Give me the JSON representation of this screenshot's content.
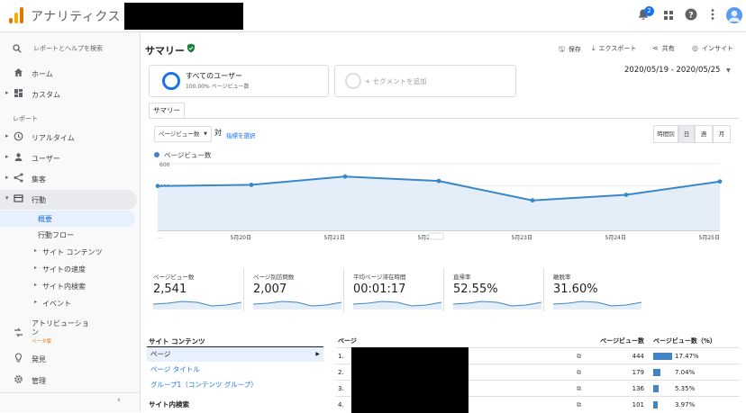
{
  "app": {
    "title": "アナリティクス",
    "notification_count": "2"
  },
  "sidebar": {
    "search_placeholder": "レポートとヘルプを検索",
    "home": "ホーム",
    "custom": "カスタム",
    "reports_section": "レポート",
    "realtime": "リアルタイム",
    "users": "ユーザー",
    "acquisition": "集客",
    "behavior": "行動",
    "overview": "概要",
    "behavior_flow": "行動フロー",
    "site_content": "サイト コンテンツ",
    "site_speed": "サイトの速度",
    "site_search": "サイト内検索",
    "events": "イベント",
    "attribution_line1": "アトリビューショ",
    "attribution_line2": "ン",
    "beta": "ベータ版",
    "discover": "発見",
    "admin": "管理"
  },
  "header": {
    "title": "サマリー",
    "save": "保存",
    "export": "エクスポート",
    "share": "共有",
    "insights": "インサイト"
  },
  "segments": {
    "all_users": "すべてのユーザー",
    "all_users_sub": "100.00% ページビュー数",
    "add_segment": "+ セグメントを追加"
  },
  "date_range": "2020/05/19 - 2020/05/25",
  "tab": "サマリー",
  "controls": {
    "metric": "ページビュー数",
    "vs": "対",
    "choose_metric": "指標を選択",
    "hourly": "時間別",
    "day": "日",
    "week": "週",
    "month": "月"
  },
  "chart_data": {
    "type": "line",
    "series": [
      {
        "name": "ページビュー数",
        "values": [
          400,
          410,
          485,
          445,
          270,
          320,
          440
        ]
      }
    ],
    "x": [
      "5/19",
      "5/20",
      "5/21",
      "5/22",
      "5/23",
      "5/24",
      "5/25"
    ],
    "x_tick_labels": [
      "...",
      "5月20日",
      "5月21日",
      "5月22日",
      "5月23日",
      "5月24日",
      "5月25日"
    ],
    "y_ticks": [
      "600",
      "400",
      "200"
    ],
    "ylim": [
      0,
      600
    ],
    "grid": true,
    "legend": "top-left",
    "color": "#3a87c8"
  },
  "scorecards": [
    {
      "label": "ページビュー数",
      "value": "2,541"
    },
    {
      "label": "ページ別訪問数",
      "value": "2,007"
    },
    {
      "label": "平均ページ滞在時間",
      "value": "00:01:17"
    },
    {
      "label": "直帰率",
      "value": "52.55%"
    },
    {
      "label": "離脱率",
      "value": "31.60%"
    }
  ],
  "left_table": {
    "header": "サイト コンテンツ",
    "rows": [
      "ページ",
      "ページ タイトル",
      "グループ1（コンテンツ グループ）"
    ],
    "header2": "サイト内検索"
  },
  "right_table": {
    "col_page": "ページ",
    "col_pv": "ページビュー数",
    "col_pct": "ページビュー数（%）",
    "rows": [
      {
        "num": "1.",
        "pv": "444",
        "pct": "17.47%",
        "share": 0.1747
      },
      {
        "num": "2.",
        "pv": "179",
        "pct": "7.04%",
        "share": 0.0704
      },
      {
        "num": "3.",
        "pv": "136",
        "pct": "5.35%",
        "share": 0.0535
      },
      {
        "num": "4.",
        "pv": "101",
        "pct": "3.97%",
        "share": 0.0397
      }
    ]
  },
  "colors": {
    "accent": "#1a73e8",
    "chart_line": "#3a87c8",
    "chart_fill": "#e3eef9"
  }
}
